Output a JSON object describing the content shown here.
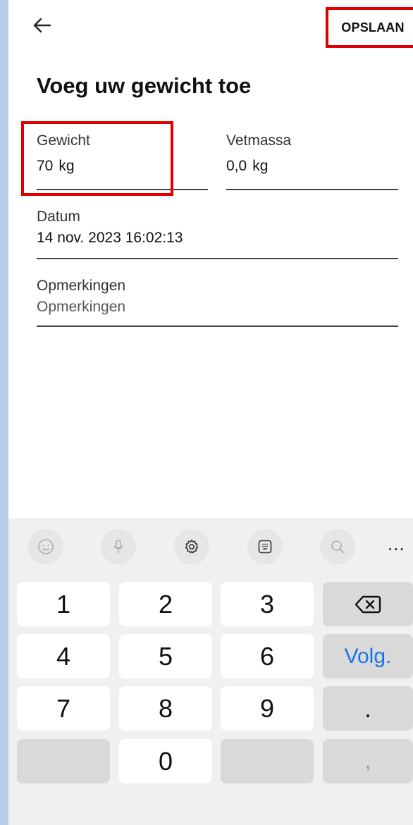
{
  "header": {
    "back_icon": "arrow-left-icon",
    "save_label": "OPSLAAN"
  },
  "page": {
    "title": "Voeg uw gewicht toe"
  },
  "fields": {
    "weight": {
      "label": "Gewicht",
      "value": "70",
      "unit": "kg"
    },
    "fat": {
      "label": "Vetmassa",
      "value": "0,0",
      "unit": "kg"
    },
    "date": {
      "label": "Datum",
      "value": "14 nov. 2023 16:02:13"
    },
    "notes": {
      "label": "Opmerkingen",
      "placeholder": "Opmerkingen"
    }
  },
  "keyboard": {
    "toolbar": [
      "emoji-icon",
      "microphone-icon",
      "settings-icon",
      "keypad-icon",
      "search-icon",
      "more-icon"
    ],
    "more_label": "...",
    "keys": {
      "k1": "1",
      "k2": "2",
      "k3": "3",
      "k4": "4",
      "k5": "5",
      "k6": "6",
      "k7": "7",
      "k8": "8",
      "k9": "9",
      "k0": "0",
      "next": "Volg.",
      "dot": ".",
      "comma": ","
    },
    "backspace_icon": "backspace-icon"
  },
  "colors": {
    "highlight": "#e00000",
    "accent": "#1a73e8",
    "sidebar_bg": "#b9cdea"
  }
}
